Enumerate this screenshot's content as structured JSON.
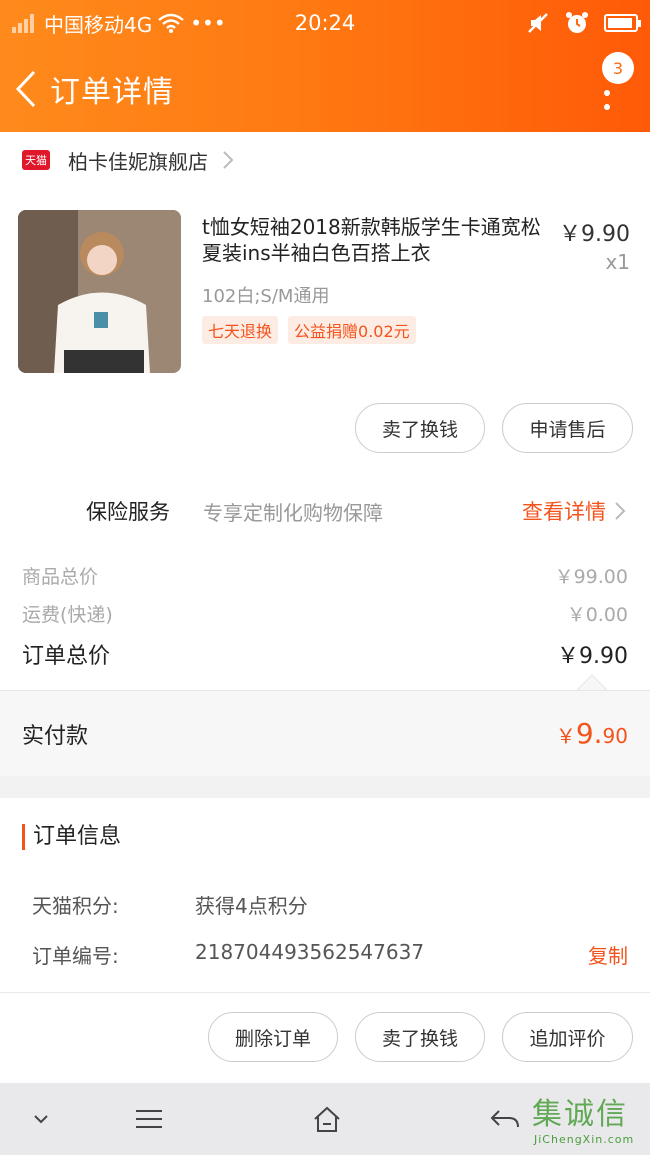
{
  "status_bar": {
    "carrier": "中国移动4G",
    "dots": "•••",
    "time": "20:24"
  },
  "nav": {
    "title": "订单详情",
    "badge_count": "3"
  },
  "shop": {
    "logo_text": "天猫",
    "name": "柏卡佳妮旗舰店"
  },
  "product": {
    "title": "t恤女短袖2018新款韩版学生卡通宽松夏装ins半袖白色百搭上衣",
    "price": "￥9.90",
    "qty": "x1",
    "sku": "102白;S/M通用",
    "tags": [
      "七天退换",
      "公益捐赠0.02元"
    ]
  },
  "product_actions": {
    "sell": "卖了换钱",
    "after_sale": "申请售后"
  },
  "insurance": {
    "label": "保险服务",
    "desc": "专享定制化购物保障",
    "link": "查看详情"
  },
  "prices": {
    "goods_label": "商品总价",
    "goods_value": "￥99.00",
    "shipping_label": "运费(快递)",
    "shipping_value": "￥0.00",
    "total_label": "订单总价",
    "total_value": "￥9.90"
  },
  "paid": {
    "label": "实付款",
    "currency": "￥",
    "integer": "9.",
    "decimal": "90"
  },
  "order_info": {
    "title": "订单信息",
    "points_key": "天猫积分:",
    "points_val": "获得4点积分",
    "number_key": "订单编号:",
    "number_val": "218704493562547637",
    "copy": "复制"
  },
  "bottom_actions": {
    "delete": "删除订单",
    "sell": "卖了换钱",
    "review": "追加评价"
  },
  "watermark": {
    "text": "集诚信",
    "sub": "JiChengXin.com"
  },
  "colors": {
    "accent": "#f4541c",
    "header_start": "#ff8a1c",
    "header_end": "#ff5a08"
  }
}
